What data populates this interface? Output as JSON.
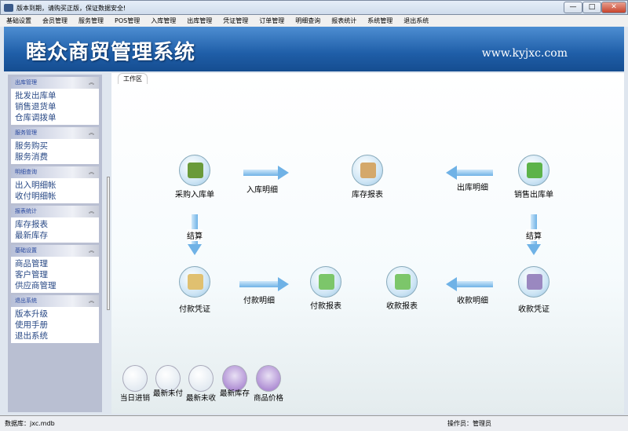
{
  "window": {
    "title": "版本到期，请购买正版，保证数据安全!",
    "min": "—",
    "max": "□",
    "close": "✕"
  },
  "menu": [
    "基础设置",
    "会员管理",
    "服务管理",
    "POS管理",
    "入库管理",
    "出库管理",
    "凭证管理",
    "订单管理",
    "明细查询",
    "报表统计",
    "系统管理",
    "退出系统"
  ],
  "banner": {
    "name": "睦众商贸管理系统",
    "url": "www.kyjxc.com"
  },
  "sidebar": [
    {
      "title": "出库管理",
      "items": [
        "批发出库单",
        "销售退货单",
        "仓库调拨单"
      ]
    },
    {
      "title": "服务管理",
      "items": [
        "服务购买",
        "服务消费"
      ]
    },
    {
      "title": "明细查询",
      "items": [
        "出入明细帐",
        "收付明细帐"
      ]
    },
    {
      "title": "报表统计",
      "items": [
        "库存报表",
        "最新库存"
      ]
    },
    {
      "title": "基础设置",
      "items": [
        "商品管理",
        "客户管理",
        "供应商管理"
      ]
    },
    {
      "title": "退出系统",
      "items": [
        "版本升级",
        "使用手册",
        "退出系统"
      ]
    }
  ],
  "collapse_glyph": "︽",
  "tab": "工作区",
  "nodes": {
    "purchase_in": "采购入库单",
    "stock_report": "库存报表",
    "sales_out": "销售出库单",
    "pay_voucher": "付款凭证",
    "pay_report": "付款报表",
    "receive_report": "收款报表",
    "receive_voucher": "收款凭证"
  },
  "arrows": {
    "in_detail": "入库明细",
    "out_detail": "出库明细",
    "settle_left": "结算",
    "settle_right": "结算",
    "pay_detail": "付款明细",
    "receive_detail": "收款明细"
  },
  "quick": [
    "当日进销",
    "最新未付",
    "最新未收",
    "最新库存",
    "商品价格"
  ],
  "status": {
    "db": "数据库：jxc.mdb",
    "operator": "操作员：管理员"
  }
}
